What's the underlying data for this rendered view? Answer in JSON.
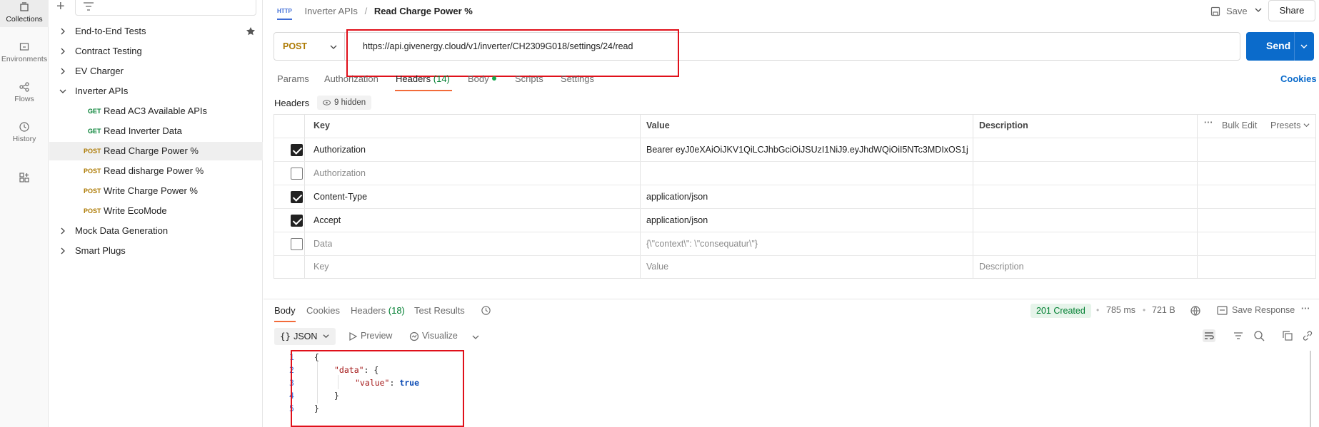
{
  "rail": {
    "items": [
      {
        "label": "Collections",
        "icon": "collections-icon",
        "active": true
      },
      {
        "label": "Environments",
        "icon": "environments-icon"
      },
      {
        "label": "Flows",
        "icon": "flows-icon"
      },
      {
        "label": "History",
        "icon": "history-icon"
      },
      {
        "label": "",
        "icon": "apps-icon"
      }
    ]
  },
  "sidebar": {
    "items": [
      {
        "label": "End-to-End Tests",
        "type": "folder",
        "starred": true
      },
      {
        "label": "Contract Testing",
        "type": "folder"
      },
      {
        "label": "EV Charger",
        "type": "folder"
      },
      {
        "label": "Inverter APIs",
        "type": "folder",
        "expanded": true
      },
      {
        "method": "GET",
        "label": "Read AC3 Available APIs",
        "type": "request"
      },
      {
        "method": "GET",
        "label": "Read Inverter Data",
        "type": "request"
      },
      {
        "method": "POST",
        "label": "Read Charge Power %",
        "type": "request",
        "active": true
      },
      {
        "method": "POST",
        "label": "Read disharge Power %",
        "type": "request"
      },
      {
        "method": "POST",
        "label": "Write Charge Power %",
        "type": "request"
      },
      {
        "method": "POST",
        "label": "Write EcoMode",
        "type": "request"
      },
      {
        "label": "Mock Data Generation",
        "type": "folder"
      },
      {
        "label": "Smart Plugs",
        "type": "folder"
      }
    ]
  },
  "topbar": {
    "http_icon": "HTTP",
    "breadcrumb_parent": "Inverter APIs",
    "breadcrumb_sep": "/",
    "breadcrumb_current": "Read Charge Power %",
    "save_label": "Save",
    "share_label": "Share"
  },
  "request": {
    "method": "POST",
    "url": "https://api.givenergy.cloud/v1/inverter/CH2309G018/settings/24/read",
    "send_label": "Send",
    "tabs": [
      {
        "label": "Params"
      },
      {
        "label": "Authorization"
      },
      {
        "label": "Headers",
        "count": "(14)",
        "active": true
      },
      {
        "label": "Body",
        "dot": true
      },
      {
        "label": "Scripts"
      },
      {
        "label": "Settings"
      }
    ],
    "cookies_label": "Cookies"
  },
  "headers": {
    "section_label": "Headers",
    "hidden_label": "9 hidden",
    "columns": {
      "key": "Key",
      "value": "Value",
      "description": "Description"
    },
    "bulk_edit": "Bulk Edit",
    "presets": "Presets",
    "rows": [
      {
        "checked": true,
        "key": "Authorization",
        "value": "Bearer eyJ0eXAiOiJKV1QiLCJhbGciOiJSUzI1NiJ9.eyJhdWQiOiI5NTc3MDIxOS1j..."
      },
      {
        "checked": false,
        "key": "Authorization",
        "value": ""
      },
      {
        "checked": true,
        "key": "Content-Type",
        "value": "application/json"
      },
      {
        "checked": true,
        "key": "Accept",
        "value": "application/json"
      },
      {
        "checked": false,
        "key": "Data",
        "value": "{\\\"context\\\": \\\"consequatur\\\"}"
      }
    ],
    "placeholders": {
      "key": "Key",
      "value": "Value",
      "description": "Description"
    }
  },
  "response": {
    "tabs": [
      {
        "label": "Body",
        "active": true
      },
      {
        "label": "Cookies"
      },
      {
        "label": "Headers",
        "count": "(18)"
      },
      {
        "label": "Test Results"
      }
    ],
    "status": "201 Created",
    "time": "785 ms",
    "size": "721 B",
    "save_response": "Save Response",
    "format": "JSON",
    "preview": "Preview",
    "visualize": "Visualize",
    "body_lines": [
      {
        "n": "1",
        "text": "{"
      },
      {
        "n": "2",
        "key": "\"data\"",
        "rest": ": {"
      },
      {
        "n": "3",
        "key": "\"value\"",
        "bool": "true"
      },
      {
        "n": "4",
        "text": "}"
      },
      {
        "n": "5",
        "text": "}"
      }
    ]
  },
  "colors": {
    "accent": "#0b6bcb",
    "post": "#ad7a03",
    "get": "#007f31",
    "tab_underline": "#f26b3a",
    "highlight": "#e0101a"
  }
}
